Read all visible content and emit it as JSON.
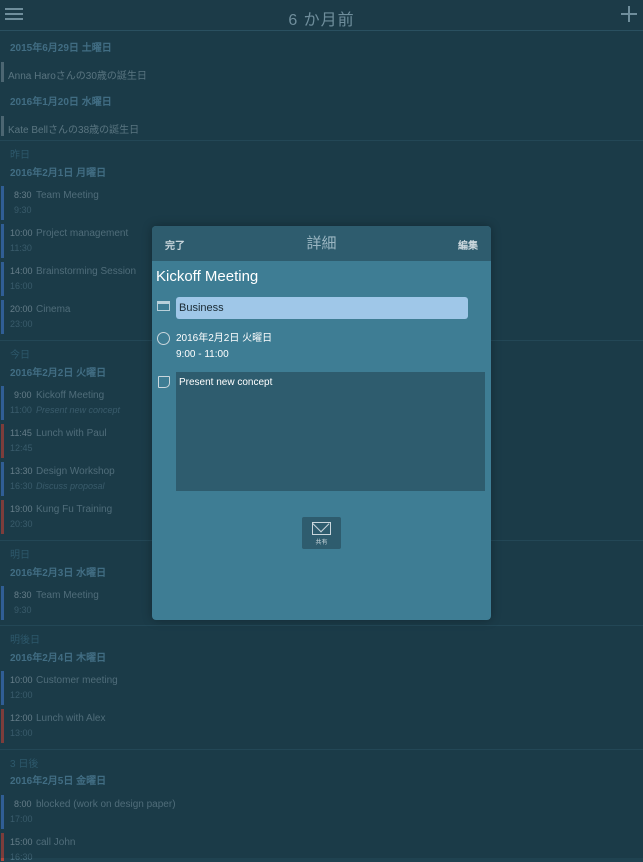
{
  "header": {
    "title": "6 か月前"
  },
  "list": {
    "date1": "2015年6月29日 土曜日",
    "allday1": "Anna Haroさんの30歳の誕生日",
    "date2": "2016年1月20日 水曜日",
    "allday2": "Kate Bellさんの38歳の誕生日",
    "label_yesterday": "昨日",
    "date3": "2016年2月1日 月曜日",
    "events_feb1": [
      {
        "start": "8:30",
        "end": "9:30",
        "title": "Team Meeting"
      },
      {
        "start": "10:00",
        "end": "11:30",
        "title": "Project management"
      },
      {
        "start": "14:00",
        "end": "16:00",
        "title": "Brainstorming Session"
      },
      {
        "start": "20:00",
        "end": "23:00",
        "title": "Cinema"
      }
    ],
    "label_today": "今日",
    "date4": "2016年2月2日 火曜日",
    "events_feb2": [
      {
        "start": "9:00",
        "end": "11:00",
        "title": "Kickoff Meeting",
        "note": "Present new concept"
      },
      {
        "start": "11:45",
        "end": "12:45",
        "title": "Lunch with Paul",
        "note": ""
      },
      {
        "start": "13:30",
        "end": "16:30",
        "title": "Design Workshop",
        "note": "Discuss proposal"
      },
      {
        "start": "19:00",
        "end": "20:30",
        "title": "Kung Fu Training",
        "note": ""
      }
    ],
    "label_tomorrow": "明日",
    "date5": "2016年2月3日 水曜日",
    "events_feb3": [
      {
        "start": "8:30",
        "end": "9:30",
        "title": "Team Meeting"
      }
    ],
    "label_dayafter": "明後日",
    "date6": "2016年2月4日 木曜日",
    "events_feb4": [
      {
        "start": "10:00",
        "end": "12:00",
        "title": "Customer meeting"
      },
      {
        "start": "12:00",
        "end": "13:00",
        "title": "Lunch with Alex"
      }
    ],
    "label_3days": "3 日後",
    "date7": "2016年2月5日 金曜日",
    "events_feb5": [
      {
        "start": "8:00",
        "end": "17:00",
        "title": "blocked (work on design paper)"
      },
      {
        "start": "15:00",
        "end": "16:30",
        "title": "call John"
      }
    ]
  },
  "popover": {
    "done": "完了",
    "title": "詳細",
    "edit": "編集",
    "event_name": "Kickoff Meeting",
    "calendar": "Business",
    "date": "2016年2月2日 火曜日",
    "time": "9:00 - 11:00",
    "note": "Present new concept",
    "share_label": "共有"
  },
  "colors": {
    "blue_bar": "#3f78c7",
    "red_bar": "#b4463c",
    "gray_bar": "#6a8591",
    "calendar_field": "#9fc7e8"
  }
}
